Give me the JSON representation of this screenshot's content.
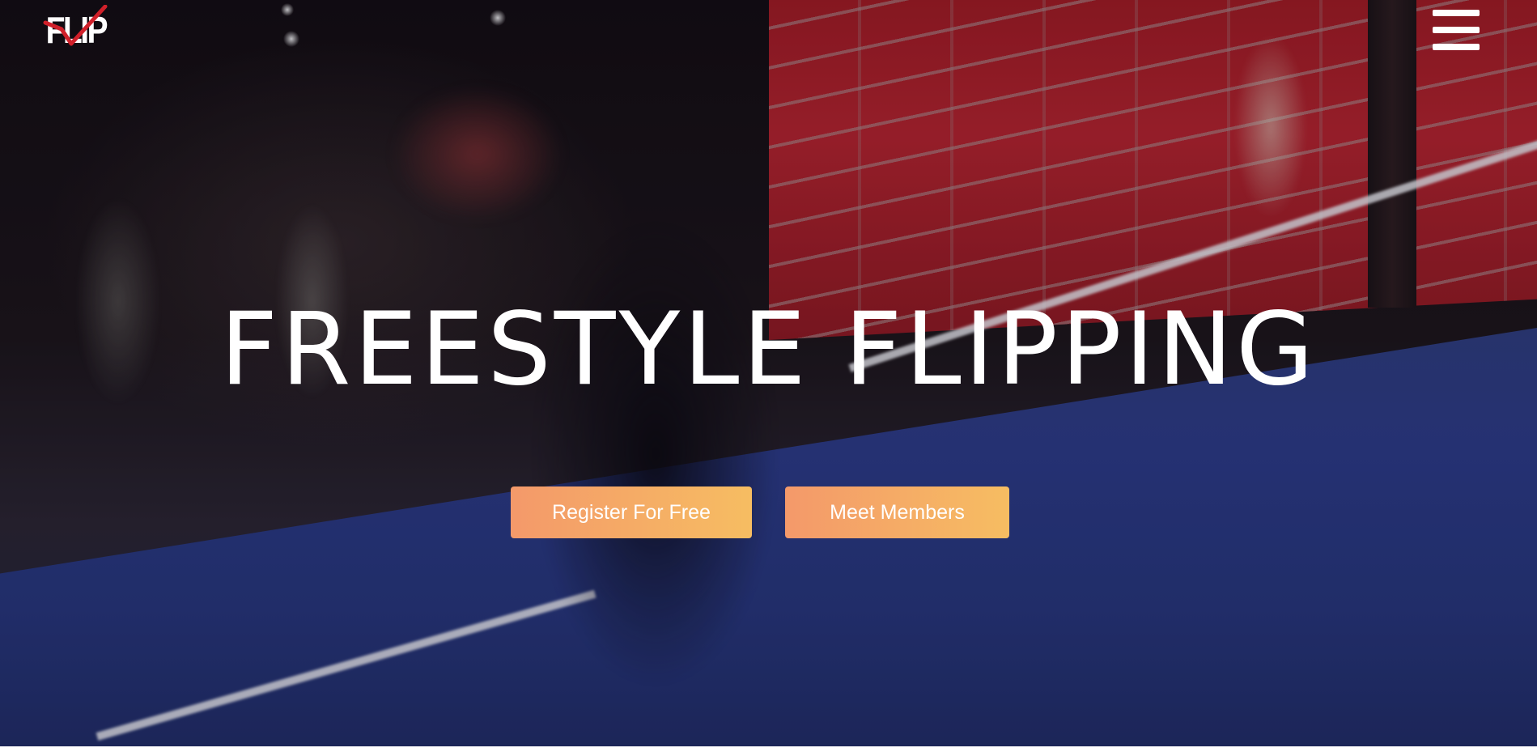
{
  "header": {
    "logo_text": "FLIP",
    "logo_check_color": "#d0202a",
    "menu_icon": "hamburger-menu-icon"
  },
  "hero": {
    "headline": "FREESTYLE FLIPPING",
    "primary_button_label": "Register For Free",
    "secondary_button_label": "Meet Members",
    "button_gradient": [
      "#f4996a",
      "#f6bd62"
    ],
    "text_color": "#ffffff"
  }
}
